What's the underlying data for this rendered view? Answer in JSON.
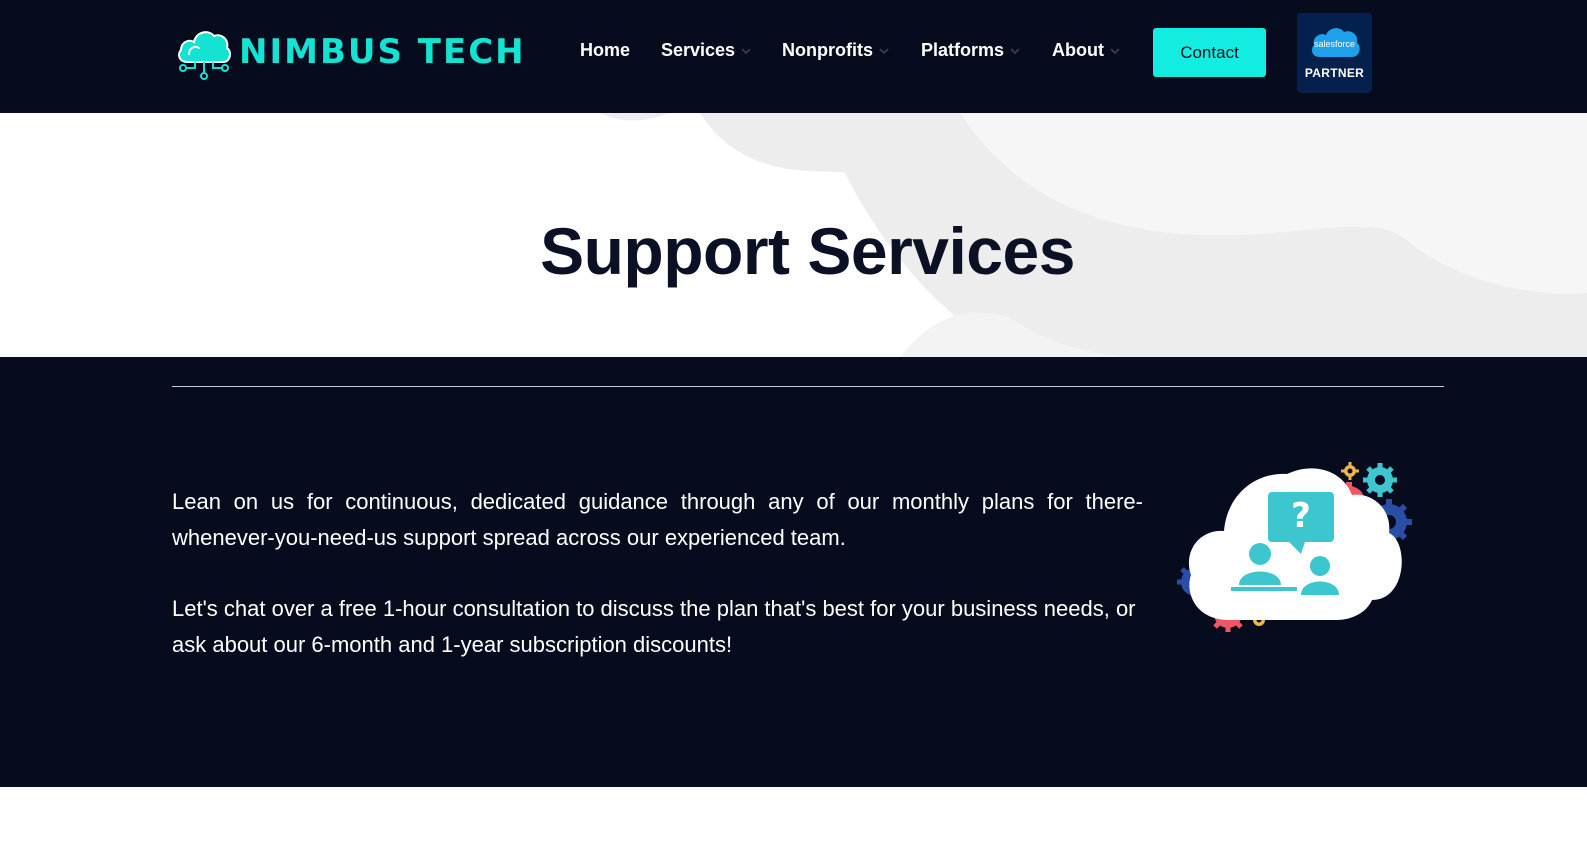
{
  "brand": {
    "name": "NIMBUS TECH",
    "logo_icon": "cloud-circuit-icon",
    "accent_color": "#14e3d3"
  },
  "nav": {
    "items": [
      {
        "label": "Home",
        "has_dropdown": false
      },
      {
        "label": "Services",
        "has_dropdown": true
      },
      {
        "label": "Nonprofits",
        "has_dropdown": true
      },
      {
        "label": "Platforms",
        "has_dropdown": true
      },
      {
        "label": "About",
        "has_dropdown": true
      }
    ],
    "contact_label": "Contact",
    "contact_color": "#13ece0"
  },
  "partner_badge": {
    "cloud_text": "salesforce",
    "label": "PARTNER"
  },
  "hero": {
    "title": "Support Services"
  },
  "content": {
    "paragraph_1": "Lean on us for continuous, dedicated guidance through any of our monthly plans for there-whenever-you-need-us support spread across our experienced team.",
    "paragraph_2": "Let's chat over a free 1-hour consultation to discuss the plan that's best for your business needs, or ask about our 6-month and 1-year subscription discounts!",
    "illustration": "cloud-support-gears-illustration"
  },
  "colors": {
    "nav_bg": "#070b1e",
    "content_bg": "#070b1e",
    "title_color": "#0c1024"
  }
}
